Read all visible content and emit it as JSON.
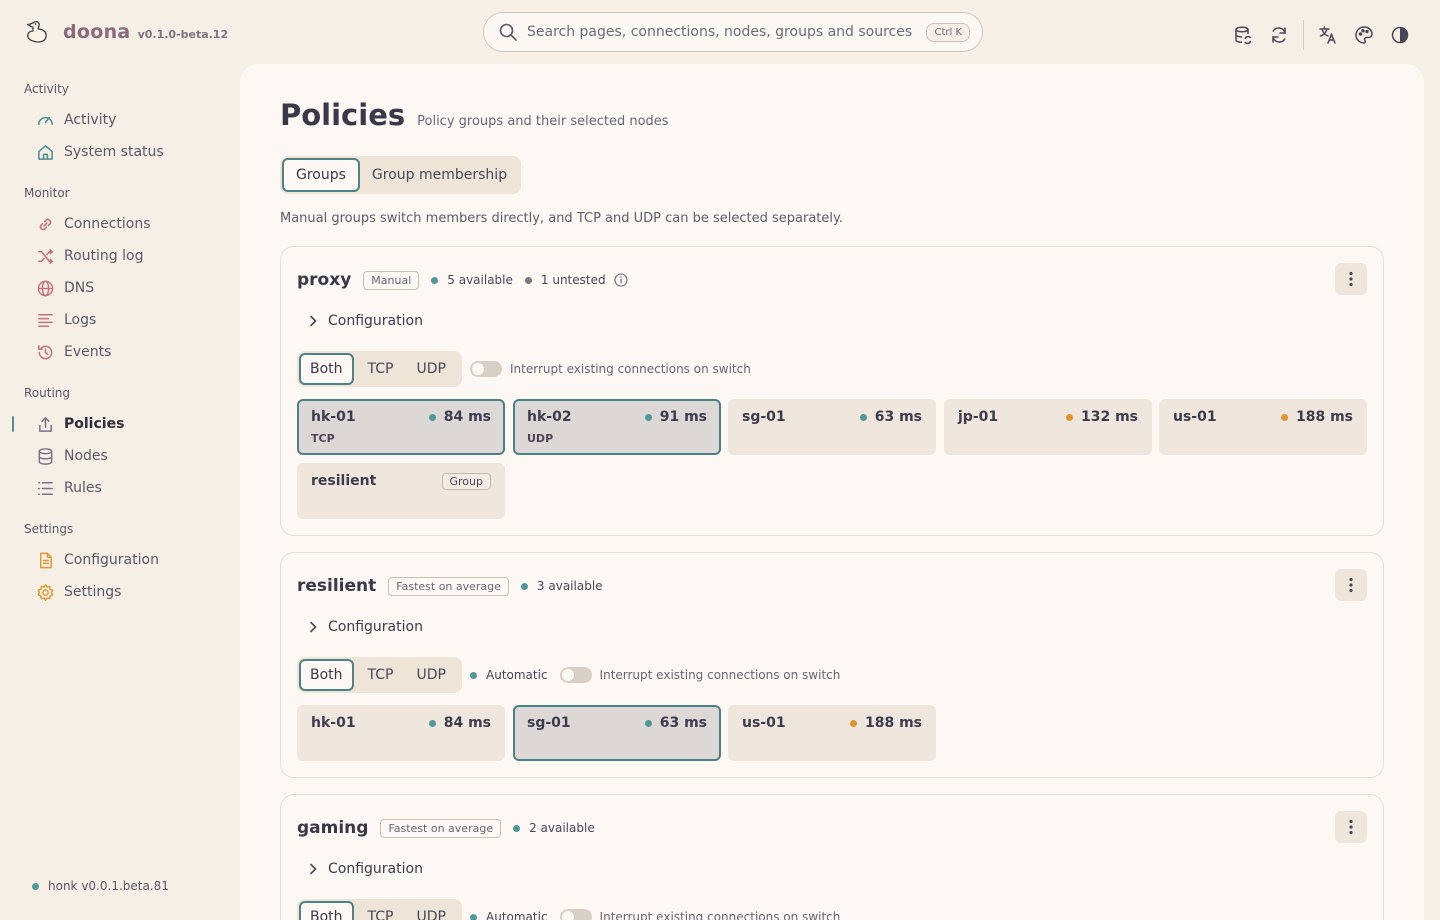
{
  "brand": {
    "name": "doona",
    "version": "v0.1.0-beta.12"
  },
  "search": {
    "placeholder": "Search pages, connections, nodes, groups and sources",
    "shortcut": "Ctrl K"
  },
  "sidebar": {
    "groups": [
      {
        "title": "Activity",
        "items": [
          {
            "label": "Activity",
            "icon": "gauge-icon"
          },
          {
            "label": "System status",
            "icon": "home-icon"
          }
        ]
      },
      {
        "title": "Monitor",
        "items": [
          {
            "label": "Connections",
            "icon": "link-icon"
          },
          {
            "label": "Routing log",
            "icon": "shuffle-icon"
          },
          {
            "label": "DNS",
            "icon": "globe-icon"
          },
          {
            "label": "Logs",
            "icon": "lines-icon"
          },
          {
            "label": "Events",
            "icon": "history-icon"
          }
        ]
      },
      {
        "title": "Routing",
        "items": [
          {
            "label": "Policies",
            "icon": "share-icon",
            "active": true
          },
          {
            "label": "Nodes",
            "icon": "database-icon"
          },
          {
            "label": "Rules",
            "icon": "list-icon"
          }
        ]
      },
      {
        "title": "Settings",
        "items": [
          {
            "label": "Configuration",
            "icon": "file-icon"
          },
          {
            "label": "Settings",
            "icon": "gear-icon"
          }
        ]
      }
    ],
    "footer": "honk v0.0.1.beta.81"
  },
  "page": {
    "title": "Policies",
    "subtitle": "Policy groups and their selected nodes",
    "tabs": [
      "Groups",
      "Group membership"
    ],
    "intro": "Manual groups switch members directly, and TCP and UDP can be selected separately."
  },
  "common": {
    "configuration": "Configuration",
    "modes": [
      "Both",
      "TCP",
      "UDP"
    ],
    "interrupt": "Interrupt existing connections on switch",
    "automatic": "Automatic"
  },
  "groups": [
    {
      "name": "proxy",
      "type": "Manual",
      "available": "5 available",
      "untested": "1 untested",
      "nodes": [
        {
          "name": "hk-01",
          "latency": "84 ms",
          "status": "green",
          "proto": "TCP"
        },
        {
          "name": "hk-02",
          "latency": "91 ms",
          "status": "green",
          "proto": "UDP"
        },
        {
          "name": "sg-01",
          "latency": "63 ms",
          "status": "green"
        },
        {
          "name": "jp-01",
          "latency": "132 ms",
          "status": "orange"
        },
        {
          "name": "us-01",
          "latency": "188 ms",
          "status": "orange"
        },
        {
          "name": "resilient",
          "tag": "Group"
        }
      ]
    },
    {
      "name": "resilient",
      "type": "Fastest on average",
      "available": "3 available",
      "nodes": [
        {
          "name": "hk-01",
          "latency": "84 ms",
          "status": "green"
        },
        {
          "name": "sg-01",
          "latency": "63 ms",
          "status": "green"
        },
        {
          "name": "us-01",
          "latency": "188 ms",
          "status": "orange"
        }
      ]
    },
    {
      "name": "gaming",
      "type": "Fastest on average",
      "available": "2 available"
    }
  ],
  "colors": {
    "accent": "#4d8386",
    "available": "#4f9a98",
    "warning": "#e0952e",
    "brand": "#8b6a7e"
  }
}
